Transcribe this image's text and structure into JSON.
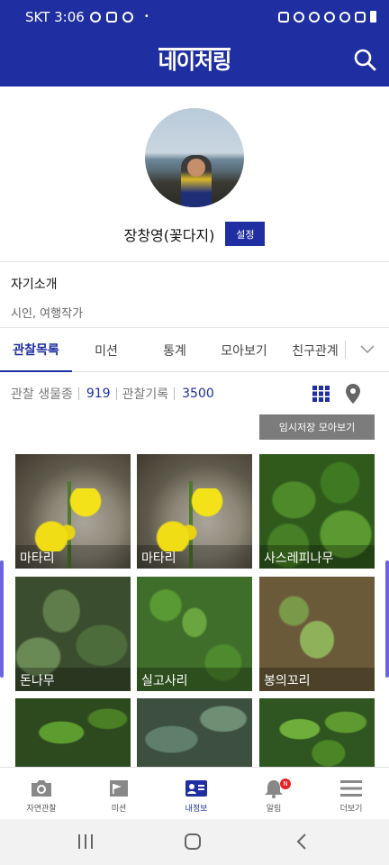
{
  "status_bar": {
    "carrier_time": "SKT 3:06",
    "dot": "•"
  },
  "header": {
    "logo": "네이처링"
  },
  "profile": {
    "name": "장창영(꽃다지)",
    "settings_label": "설정"
  },
  "intro": {
    "title": "자기소개",
    "text": "시인, 여행작가"
  },
  "tabs": [
    {
      "label": "관찰목록",
      "active": true
    },
    {
      "label": "미션"
    },
    {
      "label": "통계"
    },
    {
      "label": "모아보기"
    },
    {
      "label": "친구관계"
    }
  ],
  "stats": {
    "species_label": "관찰 생물종",
    "species_count": "919",
    "records_label": "관찰기록",
    "records_count": "3500"
  },
  "temp_button": "임시저장 모아보기",
  "photos": [
    {
      "label": "마타리"
    },
    {
      "label": "마타리"
    },
    {
      "label": "사스레피나무"
    },
    {
      "label": "돈나무"
    },
    {
      "label": "실고사리"
    },
    {
      "label": "봉의꼬리"
    },
    {
      "label": ""
    },
    {
      "label": ""
    },
    {
      "label": ""
    }
  ],
  "bottom_nav": [
    {
      "label": "자연관찰",
      "icon": "camera-icon"
    },
    {
      "label": "미션",
      "icon": "flag-icon"
    },
    {
      "label": "내정보",
      "icon": "profile-card-icon",
      "active": true
    },
    {
      "label": "알림",
      "icon": "bell-icon",
      "badge": "N"
    },
    {
      "label": "더보기",
      "icon": "menu-icon"
    }
  ],
  "colors": {
    "brand": "#1f2ea0",
    "badge": "#e02424",
    "button_gray": "#7c7c7c"
  }
}
